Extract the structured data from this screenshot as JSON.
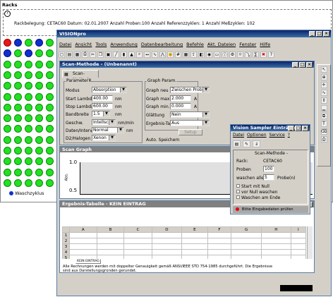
{
  "racks": {
    "title": "Racks",
    "info": "Rackbelegung: CETAC60 Datum: 02.01.2007  Anzahl Proben:100  Anzahl Referenzzyklen: 1  Anzahl Meßzyklen: 102",
    "wells": [
      "",
      "",
      "",
      "",
      "",
      "",
      "",
      "",
      "",
      "",
      "",
      "",
      "",
      "",
      "",
      "",
      "",
      "",
      "",
      "",
      "",
      "",
      "",
      "",
      "",
      "",
      "",
      "",
      "",
      "",
      "",
      "",
      "",
      "",
      "",
      "",
      "",
      "",
      "",
      "",
      "",
      "",
      "",
      "",
      "",
      "",
      "",
      "",
      "",
      "",
      "",
      "",
      "",
      "",
      "",
      "",
      "",
      "",
      "",
      "",
      "",
      "",
      "",
      "",
      "",
      "",
      "",
      "",
      "",
      ""
    ],
    "legend_wash": "Waschzyklus"
  },
  "app": {
    "title": "VISIONpro",
    "menu": [
      "Datei",
      "Ansicht",
      "Tools",
      "Anwendung",
      "Datenbearbeitung",
      "Befehle",
      "Akt. Dateien",
      "Fenster",
      "Hilfe"
    ]
  },
  "scan": {
    "title": "Scan-Methode - (Unbenannt)",
    "tab": "Scan-Methode",
    "param_group": "Parameter",
    "graph_group": "Graph Param.",
    "fields": {
      "modus_label": "Modus",
      "modus_value": "Absorption",
      "start_label": "Start Lambda",
      "start_value": "400.00",
      "start_unit": "nm",
      "stop_label": "Stop Lambda",
      "stop_value": "600.00",
      "stop_unit": "nm",
      "band_label": "Bandbreite",
      "band_value": "1.5",
      "band_unit": "nm",
      "gesch_label": "Geschw.",
      "gesch_value": "Intellscan",
      "gesch_unit": "nm/min",
      "dat_label": "Daten/Intervall",
      "dat_value": "Normal",
      "dat_unit": "nm",
      "d2_label": "D2/Halogen",
      "d2_value": "Xenon",
      "gneu_label": "Graph neu",
      "gneu_value": "Zwischen Proben",
      "gmax_label": "Graph max.",
      "gmax_value": "2.000",
      "gmax_unit": "A",
      "gmin_label": "Graph min.",
      "gmin_value": "0.000",
      "gmin_unit": "A",
      "glatt_label": "Glättung",
      "glatt_value": "Nein",
      "erg_label": "Ergebnis-Tabelle",
      "erg_value": "Aus",
      "setup": "Setup",
      "auto_save": "Auto. Speichern"
    }
  },
  "graph": {
    "title": "Scan Graph",
    "y1": "1.0",
    "y2": "0.5",
    "yunit": "Abs."
  },
  "table": {
    "title": "Ergebnis-Tabelle - KEIN EINTRAG",
    "cols": [
      "A",
      "B",
      "C",
      "D",
      "E",
      "F",
      "G",
      "H",
      "I"
    ],
    "rows": [
      "1",
      "2",
      "3",
      "4",
      "5"
    ],
    "sheet_tab": "KEIN EINTRAG",
    "footer": "Alle Rechnungen werden mit doppelter Genauigkeit gemäß ANSI/IEEE STD 754-1985 durchgeführt. Die Ergebnisse sind aus Darstellungsgründen gerundet."
  },
  "sampler": {
    "title": "Vision Sampler Einträgen",
    "menu": [
      "Datei",
      "Optionen",
      "Service",
      "?"
    ],
    "method_title": "Scan-Methode -",
    "rack_label": "Rack:",
    "rack_value": "CETAC60",
    "proben_label": "Proben",
    "proben_value": "100",
    "waschen_label": "waschen alle",
    "waschen_value": "5",
    "waschen_unit": "Probe(n)",
    "opt1": "Start mit Null",
    "opt2": "vor Null waschen",
    "opt3": "Waschen am Ende",
    "status": "Bitte Eingabedaten prüfen"
  }
}
